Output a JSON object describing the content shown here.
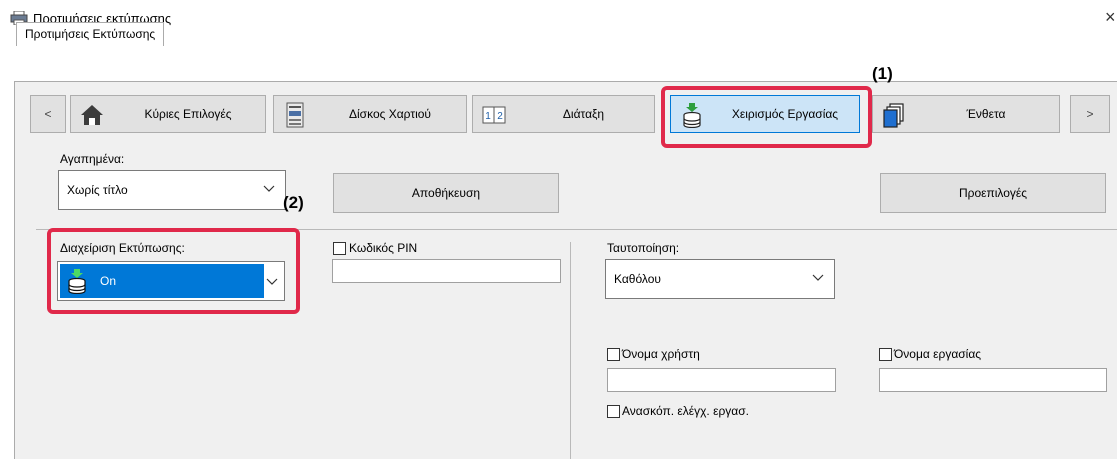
{
  "window": {
    "title": "Προτιμήσεις εκτύπωσης",
    "close_glyph": "×",
    "tab": "Προτιμήσεις Εκτύπωσης"
  },
  "toolbar": {
    "prev_label": "<",
    "next_label": ">",
    "items": [
      {
        "label": "Κύριες Επιλογές",
        "icon": "home-icon"
      },
      {
        "label": "Δίσκος Χαρτιού",
        "icon": "paper-tray-icon"
      },
      {
        "label": "Διάταξη",
        "icon": "layout-icon"
      },
      {
        "label": "Χειρισμός Εργασίας",
        "icon": "job-handling-icon",
        "active": true
      },
      {
        "label": "Ένθετα",
        "icon": "inserts-icon"
      }
    ]
  },
  "callouts": {
    "one": "(1)",
    "two": "(2)"
  },
  "favorites": {
    "label": "Αγαπημένα:",
    "value": "Χωρίς τίτλο",
    "save_label": "Αποθήκευση",
    "defaults_label": "Προεπιλογές"
  },
  "left_section": {
    "retention_label": "Διαχείριση Εκτύπωσης:",
    "retention_value": "On",
    "pin_label": "Κωδικός PIN",
    "pin_value": ""
  },
  "right_section": {
    "auth_label": "Ταυτοποίηση:",
    "auth_value": "Καθόλου",
    "username_label": "Όνομα χρήστη",
    "username_value": "",
    "jobname_label": "Όνομα εργασίας",
    "jobname_value": "",
    "preview_label": "Ανασκόπ. ελέγχ. εργασ."
  },
  "colors": {
    "accent_blue": "#0078d7",
    "callout_red": "#e0294a",
    "button_face": "#e1e1e1"
  }
}
